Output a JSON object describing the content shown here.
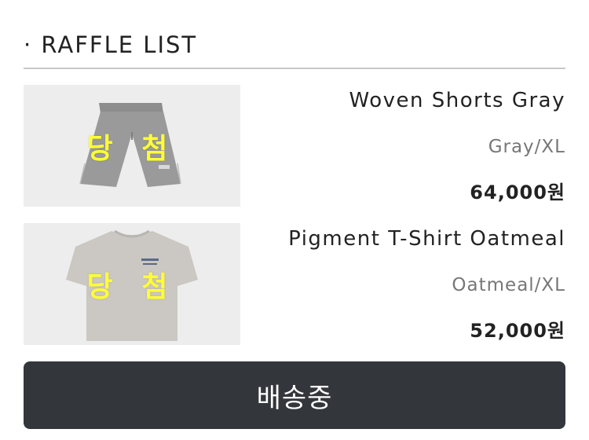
{
  "section": {
    "title": "· RAFFLE LIST"
  },
  "items": [
    {
      "badge": "당 첨",
      "name": "Woven Shorts Gray",
      "option": "Gray/XL",
      "price": "64,000원",
      "image_icon": "shorts-icon"
    },
    {
      "badge": "당 첨",
      "name": "Pigment T-Shirt Oatmeal",
      "option": "Oatmeal/XL",
      "price": "52,000원",
      "image_icon": "tshirt-icon"
    }
  ],
  "status_button": {
    "label": "배송중"
  },
  "colors": {
    "badge": "#ffff33",
    "button_bg": "#33363a",
    "thumb_bg": "#ededed"
  }
}
